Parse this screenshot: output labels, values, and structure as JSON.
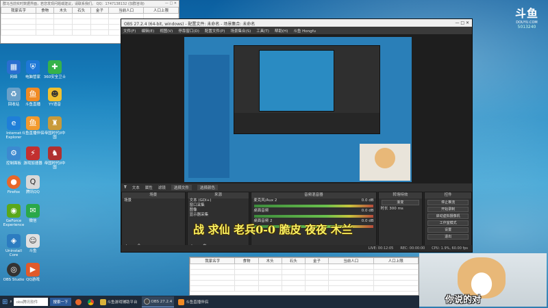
{
  "colors": {
    "desktop": "#1a86c2",
    "obs_bg": "#2b2b2b",
    "overlay_text": "#f8f060",
    "accent": "#7fb2ff"
  },
  "top_sheet": {
    "title": "群马当前实时数据界面，若您发现问题或建议，请联系我们。 QQ：1747138132 (加群咨询)",
    "columns": [
      "我家名字",
      "食物",
      "木头",
      "石头",
      "金子",
      "当前人口",
      "人口上限"
    ]
  },
  "bottom_sheet": {
    "columns": [
      "我家名字",
      "食物",
      "木头",
      "石头",
      "金子",
      "当前人口",
      "人口上限"
    ]
  },
  "desktop_icons": [
    {
      "label": "此电脑",
      "icon": "pc-icon"
    },
    {
      "label": "网络",
      "icon": "network-icon"
    },
    {
      "label": "回收站",
      "icon": "recycle-icon"
    },
    {
      "label": "Internet Explorer",
      "icon": "ie-icon"
    },
    {
      "label": "控制面板",
      "icon": "control-panel-icon"
    },
    {
      "label": "Firefox",
      "icon": "firefox-icon"
    },
    {
      "label": "GeForce Experience",
      "icon": "nvidia-icon"
    },
    {
      "label": "Uninstall Core",
      "icon": "uninstall-icon"
    },
    {
      "label": "OBS Studio",
      "icon": "obs-icon"
    },
    {
      "label": "电脑管家",
      "icon": "shield-icon"
    },
    {
      "label": "斗鱼直播",
      "icon": "douyu-icon"
    },
    {
      "label": "斗鱼直播伴侣",
      "icon": "douyu-companion-icon"
    },
    {
      "label": "游戏加速器",
      "icon": "booster-icon"
    },
    {
      "label": "腾讯QQ",
      "icon": "qq-icon"
    },
    {
      "label": "微信",
      "icon": "wechat-icon"
    },
    {
      "label": "斗鱼",
      "icon": "douyu-app-icon"
    },
    {
      "label": "QQ游戏",
      "icon": "qqgame-icon"
    },
    {
      "label": "360安全卫士",
      "icon": "360-icon"
    },
    {
      "label": "YY语音",
      "icon": "yy-icon"
    },
    {
      "label": "帝国时代II中国",
      "icon": "aoe-icon"
    },
    {
      "label": "帝国时代II中国",
      "icon": "aoe2-icon"
    }
  ],
  "obs": {
    "title": "OBS 27.2.4 (64-bit, windows) - 配置文件: 未命名 - 场景集合: 未命名",
    "menu": [
      "文件(F)",
      "编辑(E)",
      "视图(V)",
      "停靠窗口(D)",
      "配置文件(P)",
      "场景集合(S)",
      "工具(T)",
      "帮助(H)",
      "斗鱼 Hongfu"
    ],
    "source_bar": [
      "文本",
      "属性",
      "滤镜",
      "选择文件",
      "选择颜色"
    ],
    "docks": {
      "scenes": {
        "title": "场景",
        "items": [
          "场景"
        ]
      },
      "sources": {
        "title": "来源",
        "items": [
          "文本 (GDI+)",
          "窗口采集",
          "图像",
          "显示器采集"
        ]
      },
      "mixer": {
        "title": "音频混音器",
        "channels": [
          {
            "name": "麦克风/Aux 2",
            "db": "0.0 dB"
          },
          {
            "name": "桌面音频",
            "db": "0.0 dB"
          },
          {
            "name": "桌面音频 2",
            "db": "0.0 dB"
          }
        ]
      },
      "transitions": {
        "title": "转场特效",
        "type": "渐变",
        "duration_label": "时长",
        "duration": "300 ms"
      },
      "controls": {
        "title": "控件",
        "buttons": [
          "停止推流",
          "开始录制",
          "启动虚拟摄像机",
          "工作室模式",
          "设置",
          "退出"
        ]
      }
    },
    "status": {
      "live": "LIVE: 00:12:05",
      "rec": "REC: 00:00:00",
      "cpu": "CPU: 1.9%, 60.00 fps"
    }
  },
  "overlay_text": "战 求仙 老兵0-0 脆皮 夜夜 木兰",
  "logo": {
    "mark": "斗鱼",
    "sub": "DOUYU.COM",
    "room": "5013240"
  },
  "doge_caption": "你说的对",
  "taskbar": {
    "search_placeholder": "obs腾讯软件",
    "search_button": "搜索一下",
    "apps": [
      {
        "label": "",
        "icon": "firefox-icon"
      },
      {
        "label": "",
        "icon": "chrome-icon"
      },
      {
        "label": "斗鱼游戏辅助平台",
        "icon": "game-helper-icon"
      },
      {
        "label": "OBS 27.2.4",
        "icon": "obs-icon"
      },
      {
        "label": "斗鱼直播伴侣",
        "icon": "douyu-icon"
      }
    ]
  }
}
